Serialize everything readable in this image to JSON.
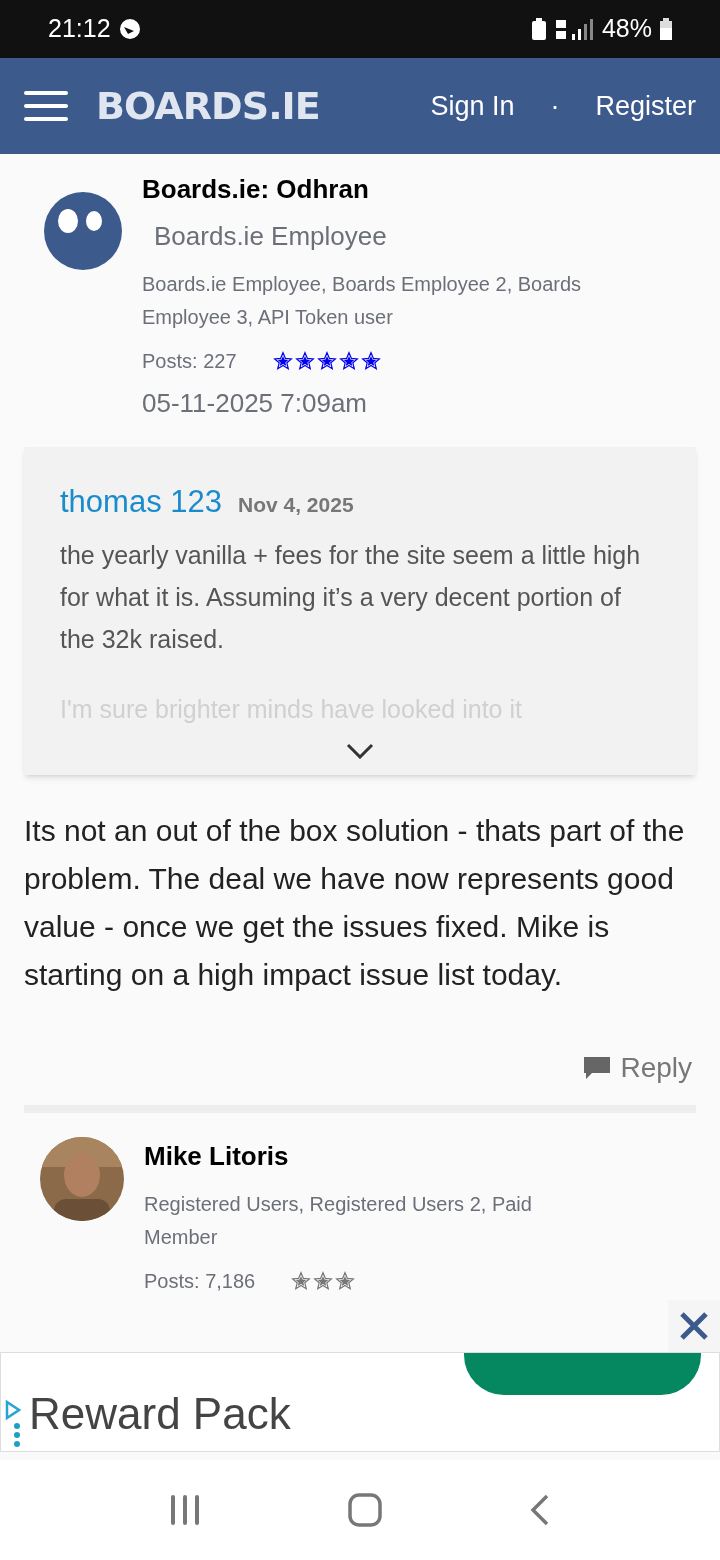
{
  "status_bar": {
    "time": "21:12",
    "battery": "48%"
  },
  "header": {
    "logo": "BOARDS.IE",
    "links": [
      "Sign In",
      "·",
      "Register"
    ]
  },
  "post": {
    "author": {
      "name": "Boards.ie: Odhran",
      "title": "Boards.ie Employee",
      "roles": "Boards.ie Employee, Boards Employee 2, Boards Employee 3, API Token user",
      "posts": "Posts: 227",
      "stars": 5,
      "color": "#0000ee"
    },
    "date": "05-11-2025 7:09am",
    "quote": {
      "author": "thomas 123",
      "date": "Nov 4, 2025",
      "lines": [
        "the yearly vanilla + fees for the site seem a little high for what it is. Assuming it’s a very decent portion of the 32k raised.",
        "I'm sure brighter minds have looked into it"
      ]
    },
    "body": "Its not an out of the box solution - thats part of the problem. The deal we have now represents good value - once we get the issues fixed. Mike is starting on a high impact issue list today.",
    "reply": "Reply"
  },
  "next_post": {
    "author": {
      "name": "Mike Litoris",
      "roles": "Registered Users, Registered Users 2, Paid Member",
      "posts": "Posts: 7,186",
      "stars": 3,
      "color": "#777777"
    }
  },
  "ad": {
    "headline": "Reward Pack"
  }
}
